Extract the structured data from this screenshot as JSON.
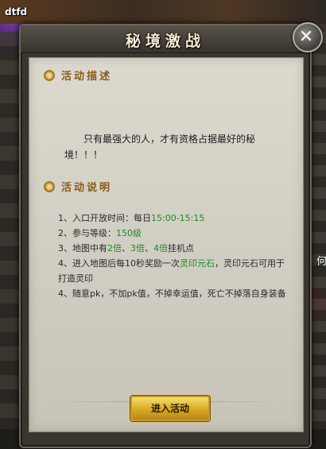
{
  "scene": {
    "player_name": "dtfd",
    "side_char": "何"
  },
  "dialog": {
    "title": "秘境激战",
    "close_icon": "close-icon",
    "section1": {
      "title": "活动描述",
      "text": "只有最强大的人，才有资格占据最好的秘境！！！"
    },
    "section2": {
      "title": "活动说明",
      "rules": [
        {
          "parts": [
            {
              "t": "1、入口开放时间：每日"
            },
            {
              "t": "15:00-15:15",
              "hl": true
            }
          ]
        },
        {
          "parts": [
            {
              "t": "2、参与等级："
            },
            {
              "t": "150级",
              "hl": true
            }
          ]
        },
        {
          "parts": [
            {
              "t": "3、地图中有"
            },
            {
              "t": "2倍",
              "hl": true
            },
            {
              "t": "、"
            },
            {
              "t": "3倍",
              "hl": true
            },
            {
              "t": "、"
            },
            {
              "t": "4倍",
              "hl": true
            },
            {
              "t": "挂机点"
            }
          ]
        },
        {
          "parts": [
            {
              "t": "4、进入地图后每10秒奖励一次"
            },
            {
              "t": "灵印元石",
              "hl": true
            },
            {
              "t": "，灵印元石可用于打造灵印"
            }
          ]
        },
        {
          "parts": [
            {
              "t": "4、随意pk，不加pk值，不掉幸运值，死亡不掉落自身装备"
            }
          ]
        }
      ]
    },
    "enter_button": "进入活动"
  },
  "colors": {
    "highlight": "#1e8a24",
    "section_title": "#8a5a13",
    "button": "#d8a825"
  }
}
